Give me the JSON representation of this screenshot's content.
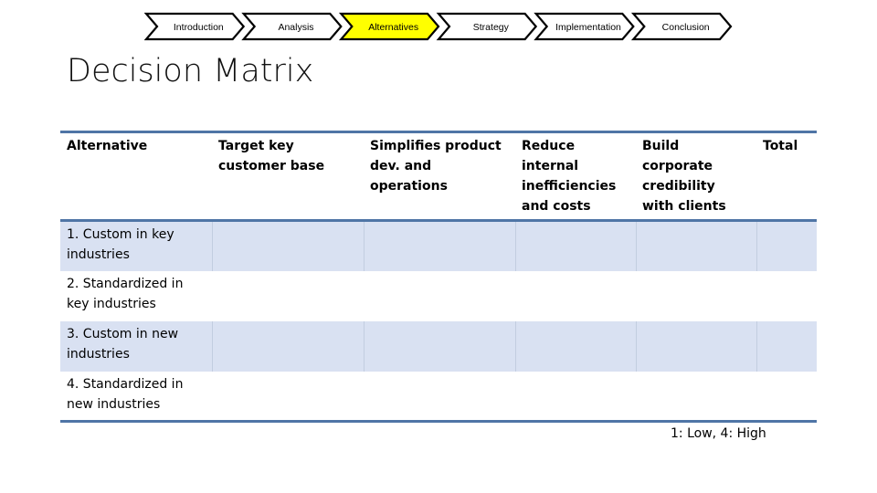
{
  "process": {
    "steps": [
      {
        "label": "Introduction",
        "active": false
      },
      {
        "label": "Analysis",
        "active": false
      },
      {
        "label": "Alternatives",
        "active": true
      },
      {
        "label": "Strategy",
        "active": false
      },
      {
        "label": "Implementation",
        "active": false
      },
      {
        "label": "Conclusion",
        "active": false
      }
    ],
    "active_color": "#ffff00",
    "inactive_color": "#ffffff"
  },
  "page": {
    "title": "Decision Matrix",
    "legend": "1: Low, 4: High"
  },
  "matrix": {
    "headers": [
      "Alternative",
      "Target key customer base",
      "Simplifies product dev. and operations",
      "Reduce internal inefficiencies and costs",
      "Build corporate credibility with clients",
      "Total"
    ],
    "rows": [
      {
        "alternative": "1. Custom in key industries",
        "scores": [
          "",
          "",
          "",
          "",
          ""
        ]
      },
      {
        "alternative": "2. Standardized in key industries",
        "scores": [
          "",
          "",
          "",
          "",
          ""
        ]
      },
      {
        "alternative": "3. Custom in new industries",
        "scores": [
          "",
          "",
          "",
          "",
          ""
        ]
      },
      {
        "alternative": "4. Standardized in new industries",
        "scores": [
          "",
          "",
          "",
          "",
          ""
        ]
      }
    ],
    "band_color": "#d9e1f2",
    "rule_color": "#4f75a6"
  }
}
